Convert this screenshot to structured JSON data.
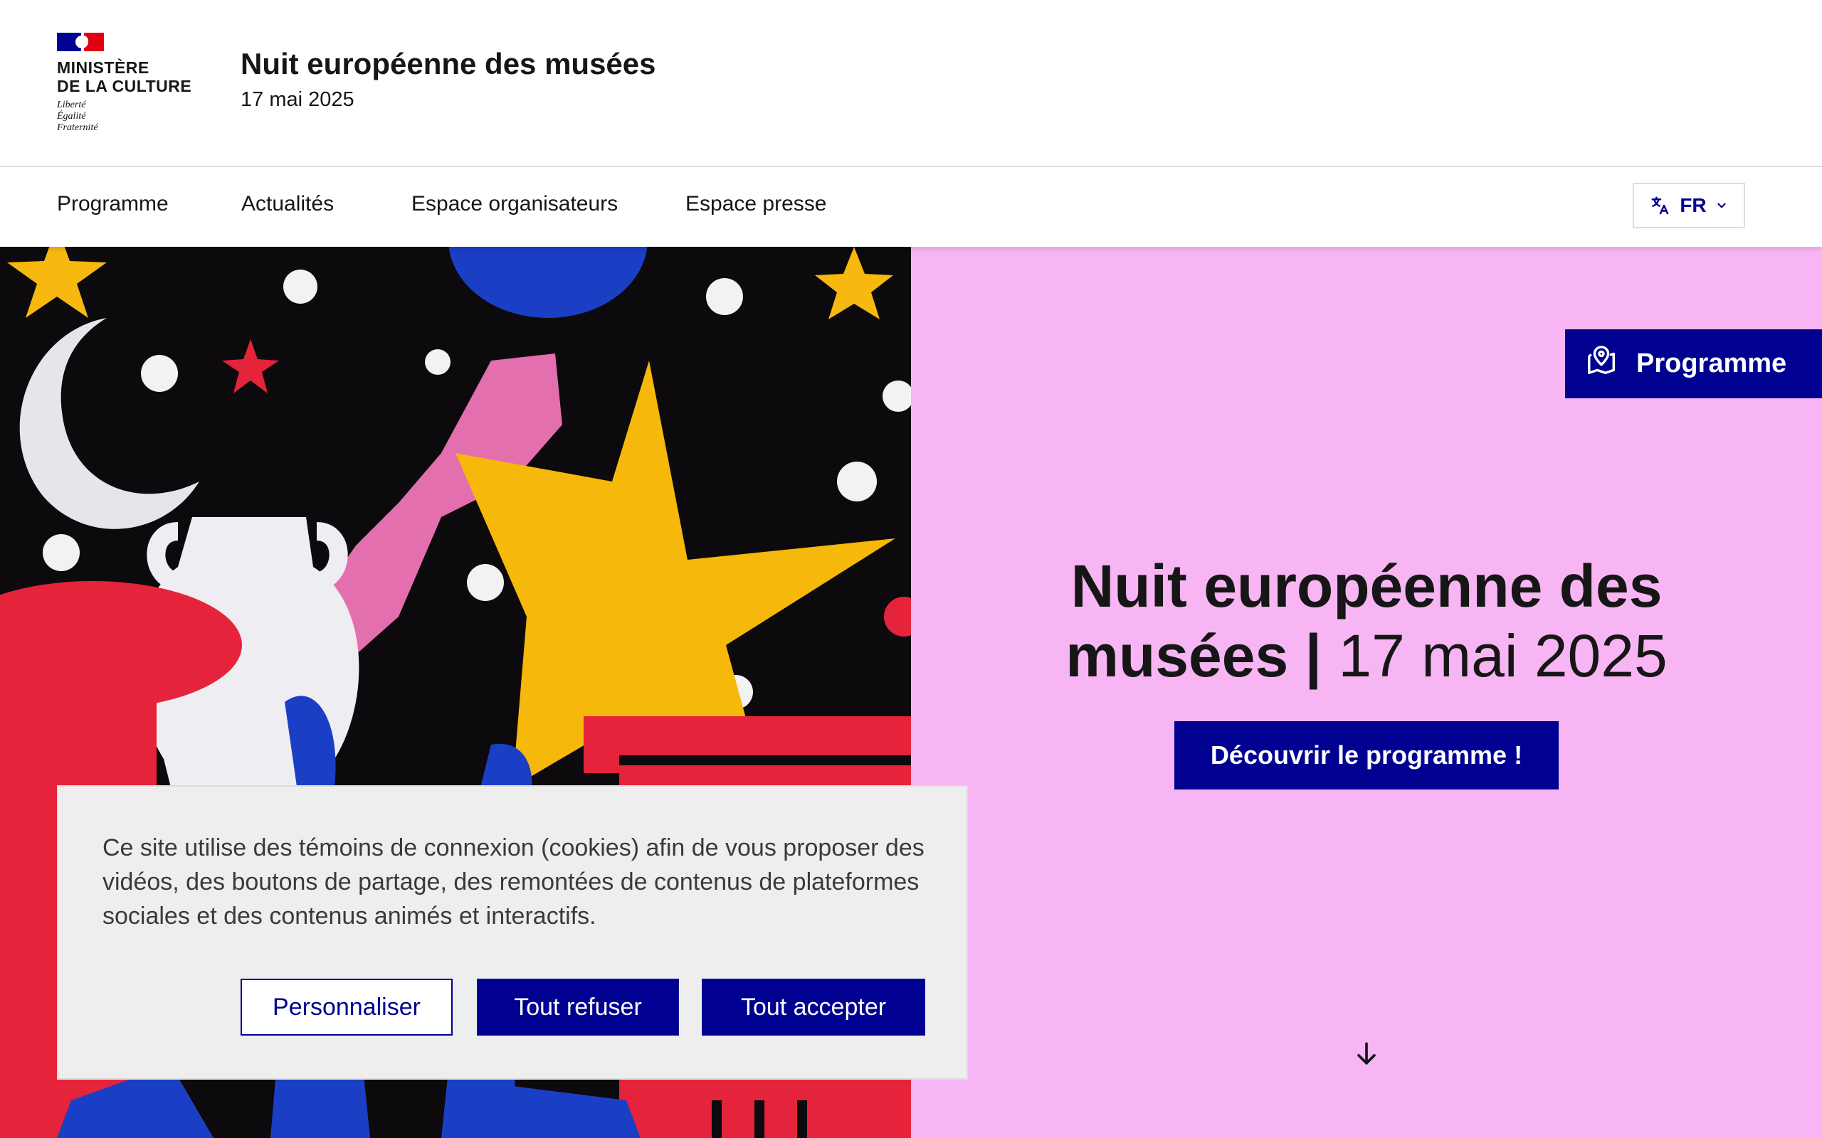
{
  "header": {
    "ministry_line1": "MINISTÈRE",
    "ministry_line2": "DE LA CULTURE",
    "motto1": "Liberté",
    "motto2": "Égalité",
    "motto3": "Fraternité",
    "site_title": "Nuit européenne des musées",
    "site_tagline": "17 mai 2025"
  },
  "nav": {
    "items": [
      {
        "label": "Programme"
      },
      {
        "label": "Actualités"
      },
      {
        "label": "Espace organisateurs"
      },
      {
        "label": "Espace presse"
      }
    ],
    "language": "FR"
  },
  "hero": {
    "program_tab": "Programme",
    "title_bold": "Nuit européenne des musées |",
    "title_date": "17 mai 2025",
    "cta": "Découvrir le programme !"
  },
  "cookie": {
    "text": "Ce site utilise des témoins de connexion (cookies) afin de vous proposer des vidéos, des boutons de partage, des remontées de contenus de plateformes sociales et des contenus animés et interactifs.",
    "personalize": "Personnaliser",
    "refuse": "Tout refuser",
    "accept": "Tout accepter"
  },
  "colors": {
    "brand_blue": "#000091",
    "hero_pink": "#f7b6f3",
    "flag_red": "#e1000f"
  },
  "icons": [
    "translate-icon",
    "chevron-down-icon",
    "map-pin-icon",
    "arrow-down-icon"
  ]
}
